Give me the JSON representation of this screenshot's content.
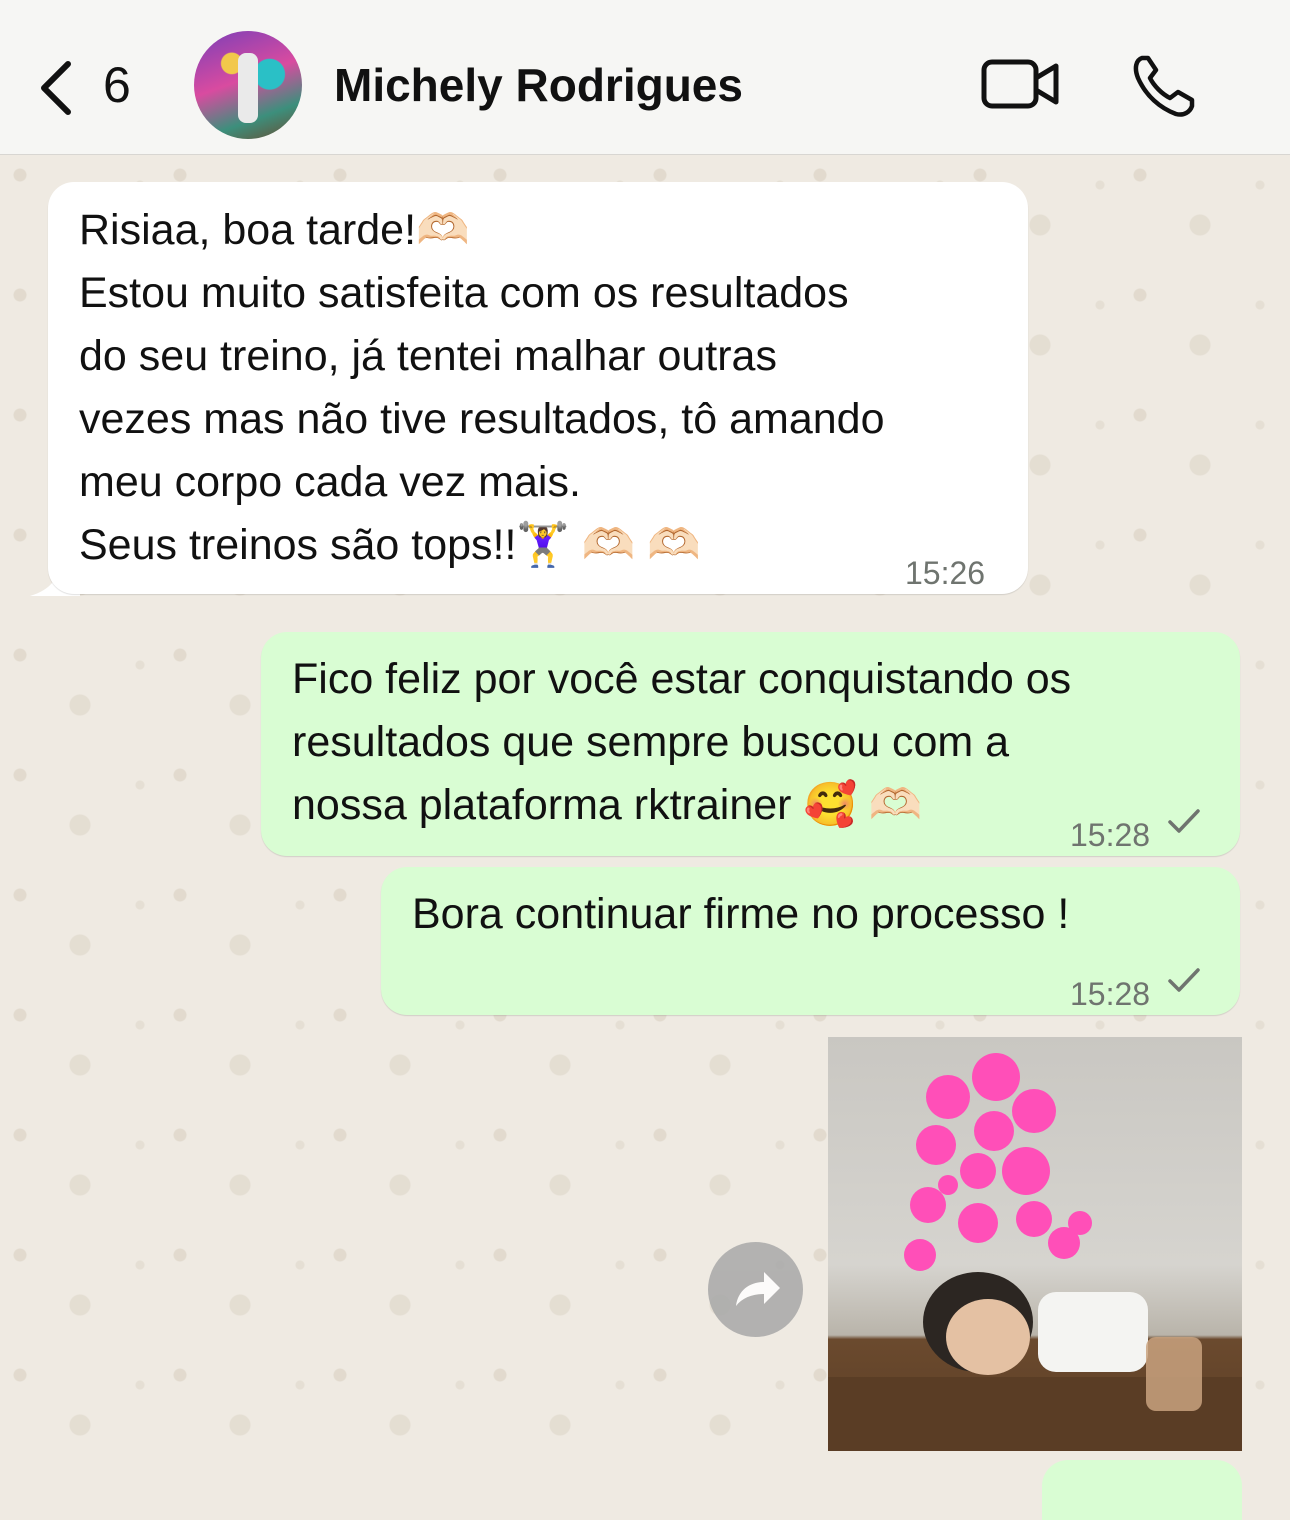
{
  "header": {
    "unread_count": "6",
    "contact_name": "Michely Rodrigues"
  },
  "messages": [
    {
      "direction": "incoming",
      "lines": [
        "Risiaa, boa tarde!🫶🏻",
        "Estou muito satisfeita com os resultados",
        "do seu treino, já tentei malhar outras",
        "vezes mas não tive resultados, tô amando",
        "meu corpo cada vez mais.",
        "Seus treinos são tops!!🏋️‍♀️ 🫶🏻 🫶🏻"
      ],
      "time": "15:26"
    },
    {
      "direction": "outgoing",
      "lines": [
        "Fico feliz por você estar conquistando os",
        "resultados que sempre buscou com a",
        "nossa plataforma rktrainer 🥰 🫶🏻"
      ],
      "time": "15:28"
    },
    {
      "direction": "outgoing",
      "lines": [
        "Bora continuar firme no processo !"
      ],
      "time": "15:28"
    },
    {
      "direction": "outgoing",
      "type": "image"
    }
  ],
  "colors": {
    "incoming_bubble": "#ffffff",
    "outgoing_bubble": "#d9fdd3",
    "chat_background": "#efeae2",
    "header_background": "#f6f6f4"
  },
  "icons": [
    "chevron-left-icon",
    "video-camera-icon",
    "phone-icon",
    "forward-icon",
    "check-icon"
  ]
}
